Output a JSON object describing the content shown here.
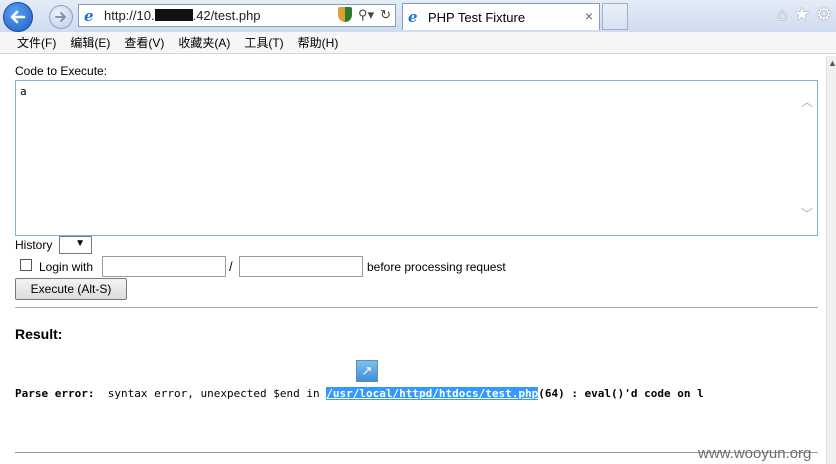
{
  "browser": {
    "url_prefix": "http://10.",
    "url_suffix": ".42/test.php",
    "tab_title": "PHP Test Fixture",
    "tab_close": "×",
    "icons": [
      "back-arrow-icon",
      "forward-arrow-icon",
      "ie-logo-icon",
      "compat-shield-icon",
      "search-icon",
      "refresh-icon",
      "home-icon",
      "favorites-star-icon",
      "gear-icon"
    ]
  },
  "menu": [
    "文件(F)",
    "编辑(E)",
    "查看(V)",
    "收藏夹(A)",
    "工具(T)",
    "帮助(H)"
  ],
  "form": {
    "code_label": "Code to Execute:",
    "code_value": "a",
    "history_label": "History",
    "login_label": "Login with",
    "slash": "/",
    "before_label": "before processing request",
    "execute_label": "Execute (Alt-S)",
    "login_checked": false
  },
  "result": {
    "heading": "Result:",
    "error_prefix": "Parse error:",
    "error_message": "syntax error, unexpected $end in",
    "error_path": "/usr/local/httpd/htdocs/test.php",
    "error_suffix": "(64) : eval()'d code on l"
  },
  "watermark": "www.wooyun.org"
}
